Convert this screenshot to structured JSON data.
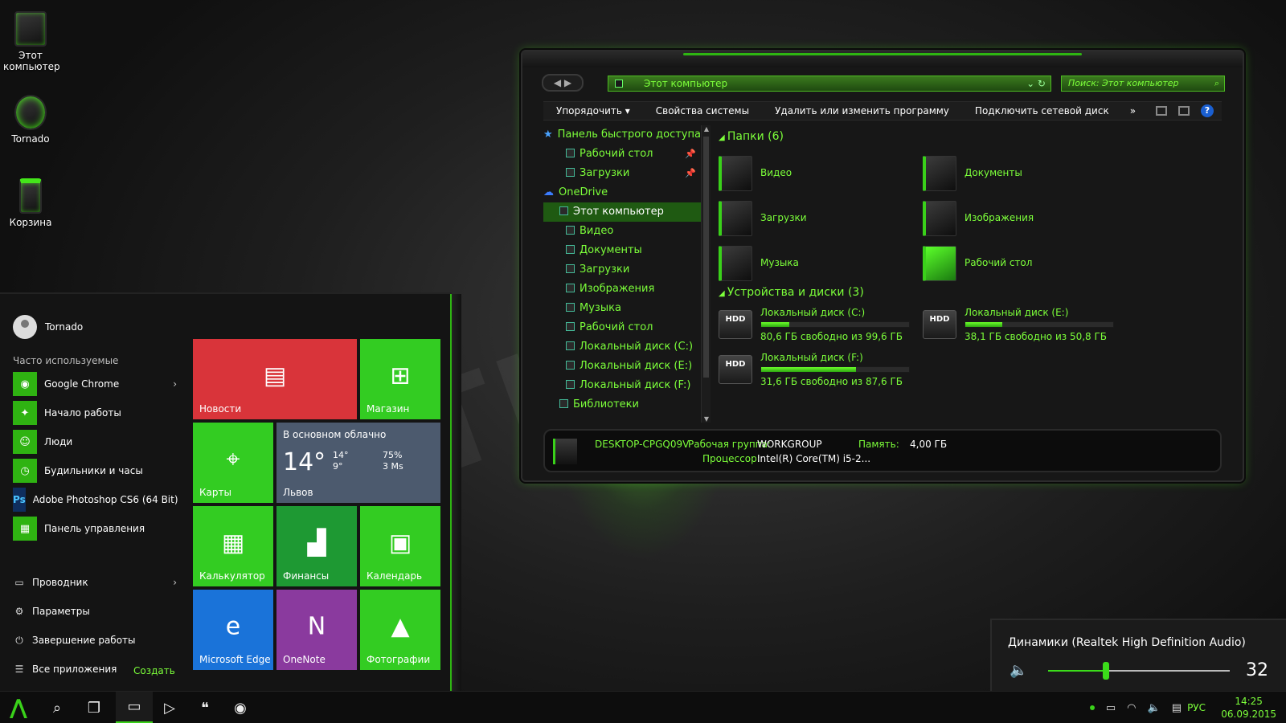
{
  "watermark": "7THEMES.SU",
  "desktop": {
    "icons": [
      {
        "label": "Этот компьютер"
      },
      {
        "label": "Tornado"
      },
      {
        "label": "Корзина"
      }
    ]
  },
  "explorer": {
    "address": "Этот компьютер",
    "search_placeholder": "Поиск: Этот компьютер",
    "commands": [
      "Упорядочить ▾",
      "Свойства системы",
      "Удалить или изменить программу",
      "Подключить сетевой диск"
    ],
    "more": "»",
    "nav": [
      {
        "label": "Панель быстрого доступа",
        "kind": "top"
      },
      {
        "label": "Рабочий стол",
        "kind": "child",
        "pinned": true
      },
      {
        "label": "Загрузки",
        "kind": "child",
        "pinned": true
      },
      {
        "label": "OneDrive",
        "kind": "top"
      },
      {
        "label": "Этот компьютер",
        "kind": "root",
        "selected": true
      },
      {
        "label": "Видео",
        "kind": "child"
      },
      {
        "label": "Документы",
        "kind": "child"
      },
      {
        "label": "Загрузки",
        "kind": "child"
      },
      {
        "label": "Изображения",
        "kind": "child"
      },
      {
        "label": "Музыка",
        "kind": "child"
      },
      {
        "label": "Рабочий стол",
        "kind": "child"
      },
      {
        "label": "Локальный диск (C:)",
        "kind": "child"
      },
      {
        "label": "Локальный диск (E:)",
        "kind": "child"
      },
      {
        "label": "Локальный диск (F:)",
        "kind": "child"
      },
      {
        "label": "Библиотеки",
        "kind": "root"
      }
    ],
    "folders_header": "Папки (6)",
    "folders": [
      "Видео",
      "Документы",
      "Загрузки",
      "Изображения",
      "Музыка",
      "Рабочий стол"
    ],
    "drives_header": "Устройства и диски (3)",
    "drives": [
      {
        "name": "Локальный диск (C:)",
        "free": "80,6 ГБ свободно из 99,6 ГБ",
        "used_fraction": 0.19,
        "icon_label": "HDD"
      },
      {
        "name": "Локальный диск (E:)",
        "free": "38,1 ГБ свободно из 50,8 ГБ",
        "used_fraction": 0.25,
        "icon_label": "HDD"
      },
      {
        "name": "Локальный диск (F:)",
        "free": "31,6 ГБ свободно из 87,6 ГБ",
        "used_fraction": 0.64,
        "icon_label": "HDD"
      }
    ],
    "details": {
      "pc_name": "DESKTOP-CPGQ09V",
      "workgroup_label": "Рабочая группа:",
      "workgroup": "WORKGROUP",
      "memory_label": "Память:",
      "memory": "4,00 ГБ",
      "cpu_label": "Процессор:",
      "cpu": "Intel(R) Core(TM) i5-2..."
    }
  },
  "start": {
    "user": "Tornado",
    "frequent_label": "Часто используемые",
    "apps": [
      {
        "label": "Google Chrome",
        "icon": "chrome-icon",
        "glyph": "◉",
        "arrow": true
      },
      {
        "label": "Начало работы",
        "icon": "lightbulb-icon",
        "glyph": "✦",
        "arrow": false
      },
      {
        "label": "Люди",
        "icon": "people-icon",
        "glyph": "☺",
        "arrow": false
      },
      {
        "label": "Будильники и часы",
        "icon": "alarm-icon",
        "glyph": "◷",
        "arrow": false
      },
      {
        "label": "Adobe Photoshop CS6 (64 Bit)",
        "icon": "photoshop-icon",
        "glyph": "Ps",
        "arrow": false
      },
      {
        "label": "Панель управления",
        "icon": "control-panel-icon",
        "glyph": "▦",
        "arrow": false
      }
    ],
    "system": [
      {
        "label": "Проводник",
        "icon": "explorer-icon",
        "glyph": "▭",
        "arrow": true
      },
      {
        "label": "Параметры",
        "icon": "gear-icon",
        "glyph": "⚙",
        "arrow": false
      },
      {
        "label": "Завершение работы",
        "icon": "power-icon",
        "glyph": "⏻",
        "arrow": false
      },
      {
        "label": "Все приложения",
        "icon": "list-icon",
        "glyph": "☰",
        "arrow": false
      }
    ],
    "create_label": "Создать",
    "tiles": [
      {
        "label": "Новости",
        "icon": "news-icon",
        "glyph": "▤",
        "color": "#d9343a"
      },
      {
        "label": "Магазин",
        "icon": "store-icon",
        "glyph": "⊞",
        "color": "#33cc22"
      },
      {
        "label": "Карты",
        "icon": "maps-icon",
        "glyph": "⌖",
        "color": "#33cc22"
      },
      {
        "label": "Калькулятор",
        "icon": "calculator-icon",
        "glyph": "▦",
        "color": "#33cc22"
      },
      {
        "label": "Финансы",
        "icon": "finance-icon",
        "glyph": "▟",
        "color": "#1e9933"
      },
      {
        "label": "Календарь",
        "icon": "calendar-icon",
        "glyph": "▣",
        "color": "#33cc22"
      },
      {
        "label": "Microsoft Edge",
        "icon": "edge-icon",
        "glyph": "e",
        "color": "#1a73d9"
      },
      {
        "label": "OneNote",
        "icon": "onenote-icon",
        "glyph": "N",
        "color": "#8a3a9e"
      },
      {
        "label": "Фотографии",
        "icon": "photos-icon",
        "glyph": "▲",
        "color": "#33cc22"
      }
    ],
    "weather": {
      "condition": "В основном облачно",
      "temp": "14°",
      "high": "14°",
      "low": "9°",
      "humidity": "75%",
      "wind": "3 Ms",
      "city": "Львов",
      "color": "#4c5a6e"
    }
  },
  "volume": {
    "device": "Динамики (Realtek High Definition Audio)",
    "level": 32
  },
  "taskbar": {
    "lang": "РУС",
    "time": "14:25",
    "date": "06.09.2015"
  }
}
